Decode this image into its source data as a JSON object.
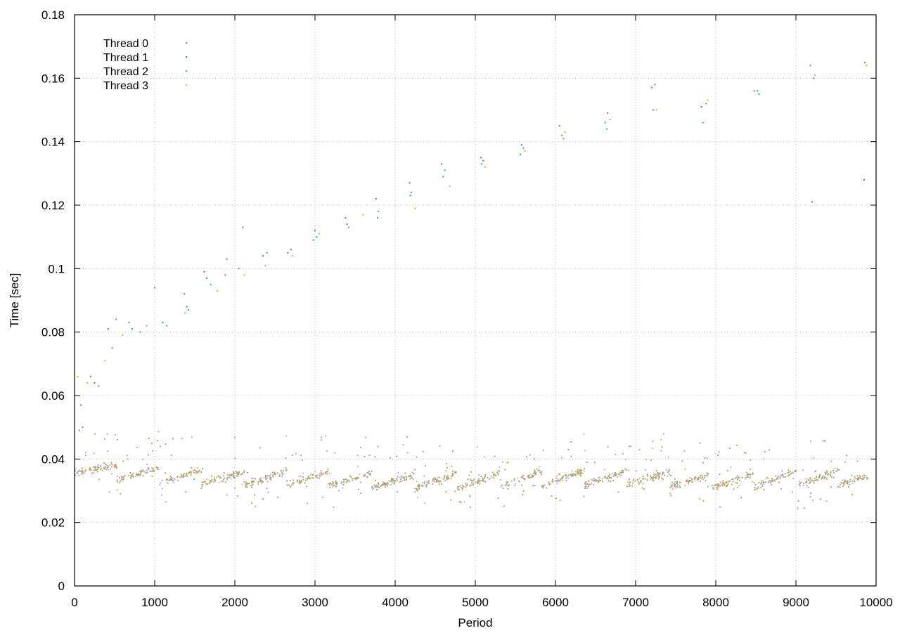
{
  "chart_data": {
    "type": "scatter",
    "title": "",
    "xlabel": "Period",
    "ylabel": "Time [sec]",
    "xlim": [
      0,
      10000
    ],
    "ylim": [
      0,
      0.18
    ],
    "x_ticks": [
      0,
      1000,
      2000,
      3000,
      4000,
      5000,
      6000,
      7000,
      8000,
      9000,
      10000
    ],
    "x_tick_labels": [
      "0",
      "1000",
      "2000",
      "3000",
      "4000",
      "5000",
      "6000",
      "7000",
      "8000",
      "9000",
      "10000"
    ],
    "y_ticks": [
      0,
      0.02,
      0.04,
      0.06,
      0.08,
      0.1,
      0.12,
      0.14,
      0.16,
      0.18
    ],
    "y_tick_labels": [
      "0",
      "0.02",
      "0.04",
      "0.06",
      "0.08",
      "0.1",
      "0.12",
      "0.14",
      "0.16",
      "0.18"
    ],
    "grid": true,
    "legend_position": "top-left",
    "series": [
      {
        "name": "Thread 0",
        "color": "#9b59d0",
        "outliers": [
          [
            60,
            0.049
          ],
          [
            200,
            0.066
          ],
          [
            420,
            0.081
          ],
          [
            680,
            0.083
          ],
          [
            1000,
            0.094
          ],
          [
            1370,
            0.092
          ],
          [
            1620,
            0.099
          ],
          [
            1900,
            0.103
          ],
          [
            2100,
            0.113
          ],
          [
            2660,
            0.105
          ],
          [
            3000,
            0.112
          ],
          [
            3380,
            0.116
          ],
          [
            3760,
            0.122
          ],
          [
            4180,
            0.127
          ],
          [
            4580,
            0.133
          ],
          [
            5070,
            0.135
          ],
          [
            5580,
            0.139
          ],
          [
            6050,
            0.145
          ],
          [
            6650,
            0.149
          ],
          [
            7200,
            0.157
          ],
          [
            7820,
            0.151
          ],
          [
            8480,
            0.156
          ],
          [
            9180,
            0.164
          ],
          [
            9860,
            0.165
          ]
        ]
      },
      {
        "name": "Thread 1",
        "color": "#2e9e6b",
        "outliers": [
          [
            80,
            0.057
          ],
          [
            250,
            0.064
          ],
          [
            470,
            0.075
          ],
          [
            720,
            0.081
          ],
          [
            1100,
            0.083
          ],
          [
            1400,
            0.088
          ],
          [
            1650,
            0.097
          ],
          [
            1880,
            0.098
          ],
          [
            2350,
            0.104
          ],
          [
            2700,
            0.106
          ],
          [
            3020,
            0.11
          ],
          [
            3400,
            0.114
          ],
          [
            3780,
            0.116
          ],
          [
            4190,
            0.123
          ],
          [
            4600,
            0.129
          ],
          [
            5100,
            0.134
          ],
          [
            5560,
            0.136
          ],
          [
            6080,
            0.142
          ],
          [
            6620,
            0.146
          ],
          [
            7220,
            0.15
          ],
          [
            7840,
            0.146
          ],
          [
            8520,
            0.156
          ],
          [
            9200,
            0.121
          ],
          [
            9850,
            0.128
          ]
        ]
      },
      {
        "name": "Thread 2",
        "color": "#3aa0d8",
        "outliers": [
          [
            100,
            0.05
          ],
          [
            300,
            0.063
          ],
          [
            520,
            0.084
          ],
          [
            820,
            0.08
          ],
          [
            1150,
            0.082
          ],
          [
            1420,
            0.087
          ],
          [
            1700,
            0.095
          ],
          [
            2050,
            0.1
          ],
          [
            2400,
            0.105
          ],
          [
            2980,
            0.109
          ],
          [
            3420,
            0.113
          ],
          [
            3790,
            0.118
          ],
          [
            4200,
            0.124
          ],
          [
            4620,
            0.131
          ],
          [
            5080,
            0.133
          ],
          [
            5600,
            0.138
          ],
          [
            6100,
            0.141
          ],
          [
            6640,
            0.144
          ],
          [
            7240,
            0.158
          ],
          [
            7880,
            0.152
          ],
          [
            8540,
            0.155
          ],
          [
            9220,
            0.16
          ]
        ]
      },
      {
        "name": "Thread 3",
        "color": "#e8a33a",
        "outliers": [
          [
            40,
            0.066
          ],
          [
            160,
            0.064
          ],
          [
            380,
            0.071
          ],
          [
            600,
            0.079
          ],
          [
            900,
            0.082
          ],
          [
            1380,
            0.086
          ],
          [
            1780,
            0.093
          ],
          [
            2120,
            0.098
          ],
          [
            2380,
            0.101
          ],
          [
            2720,
            0.104
          ],
          [
            3050,
            0.111
          ],
          [
            3600,
            0.117
          ],
          [
            4250,
            0.119
          ],
          [
            4680,
            0.126
          ],
          [
            5120,
            0.132
          ],
          [
            5620,
            0.137
          ],
          [
            6120,
            0.143
          ],
          [
            6680,
            0.147
          ],
          [
            7260,
            0.15
          ],
          [
            7900,
            0.153
          ],
          [
            9240,
            0.161
          ],
          [
            9880,
            0.164
          ]
        ]
      }
    ],
    "trend": {
      "x": [
        0,
        500,
        1000,
        2000,
        3000,
        4000,
        5000,
        6000,
        7000,
        8000,
        9000,
        9900
      ],
      "y": [
        0.038,
        0.036,
        0.035,
        0.034,
        0.034,
        0.033,
        0.033,
        0.034,
        0.034,
        0.033,
        0.034,
        0.034
      ]
    },
    "noise_points_per_series": 1400
  }
}
